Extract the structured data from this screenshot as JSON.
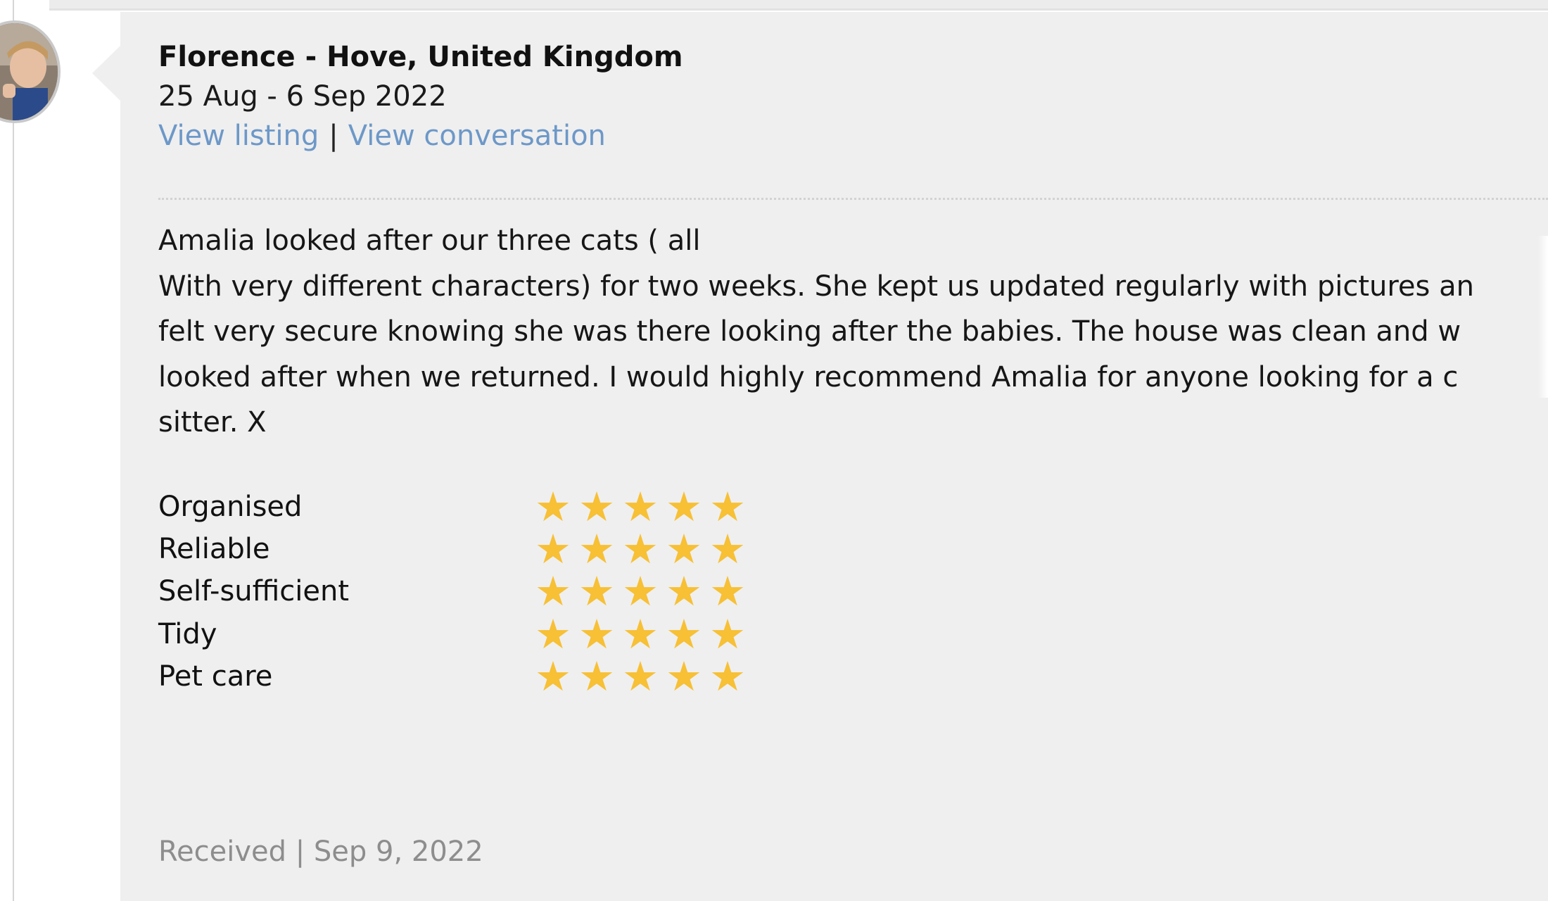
{
  "review": {
    "reviewer": "Florence - Hove, United Kingdom",
    "date_range": "25 Aug - 6 Sep 2022",
    "links": {
      "view_listing": "View listing",
      "separator": "|",
      "view_conversation": "View conversation"
    },
    "text_lines": [
      "Amalia looked after our three cats ( all",
      "With very different characters) for two weeks. She kept us updated regularly with pictures an",
      "felt very secure knowing she was there looking after the babies. The house was clean and w",
      "looked after when we returned. I would highly recommend Amalia for anyone looking for a c",
      "sitter. X"
    ],
    "ratings": [
      {
        "label": "Organised",
        "stars": 5,
        "max": 5
      },
      {
        "label": "Reliable",
        "stars": 5,
        "max": 5
      },
      {
        "label": "Self-sufficient",
        "stars": 5,
        "max": 5
      },
      {
        "label": "Tidy",
        "stars": 5,
        "max": 5
      },
      {
        "label": "Pet care",
        "stars": 5,
        "max": 5
      }
    ],
    "received": "Received | Sep 9, 2022"
  },
  "colors": {
    "card_background": "#efefef",
    "link": "#6d98c8",
    "star": "#f7c035",
    "muted_text": "#8d8d8d"
  },
  "icons": {
    "avatar": "reviewer-avatar-photo",
    "star": "star-icon"
  }
}
